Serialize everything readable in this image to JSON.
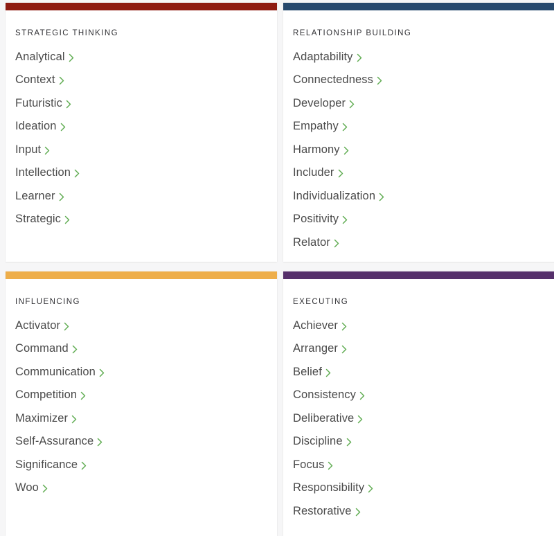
{
  "page": {
    "background_color": "#f6f6f7",
    "card_background": "#ffffff",
    "chevron_color": "#62ad54",
    "text_color": "#4a4a4a",
    "heading_color": "#2f2f33"
  },
  "domains": [
    {
      "id": "strategic-thinking",
      "title": "STRATEGIC THINKING",
      "accent_color": "#8e1b11",
      "chevron_icon": "chevron-right-icon",
      "themes": [
        "Analytical",
        "Context",
        "Futuristic",
        "Ideation",
        "Input",
        "Intellection",
        "Learner",
        "Strategic"
      ]
    },
    {
      "id": "relationship-building",
      "title": "RELATIONSHIP BUILDING",
      "accent_color": "#27496d",
      "chevron_icon": "chevron-right-icon",
      "themes": [
        "Adaptability",
        "Connectedness",
        "Developer",
        "Empathy",
        "Harmony",
        "Includer",
        "Individualization",
        "Positivity",
        "Relator"
      ]
    },
    {
      "id": "influencing",
      "title": "INFLUENCING",
      "accent_color": "#eeae4a",
      "chevron_icon": "chevron-right-icon",
      "themes": [
        "Activator",
        "Command",
        "Communication",
        "Competition",
        "Maximizer",
        "Self-Assurance",
        "Significance",
        "Woo"
      ]
    },
    {
      "id": "executing",
      "title": "EXECUTING",
      "accent_color": "#56306b",
      "chevron_icon": "chevron-right-icon",
      "themes": [
        "Achiever",
        "Arranger",
        "Belief",
        "Consistency",
        "Deliberative",
        "Discipline",
        "Focus",
        "Responsibility",
        "Restorative"
      ]
    }
  ]
}
